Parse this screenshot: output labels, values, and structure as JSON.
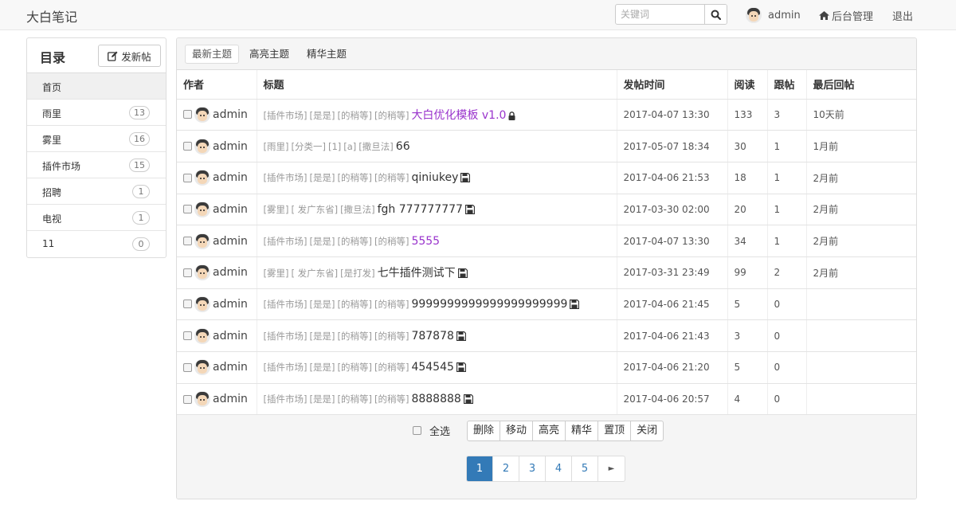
{
  "nav": {
    "brand": "大白笔记",
    "search_placeholder": "关键词",
    "username": "admin",
    "admin_link": "后台管理",
    "logout": "退出"
  },
  "sidebar": {
    "title": "目录",
    "new_post": "发新帖",
    "items": [
      {
        "label": "首页",
        "count": ""
      },
      {
        "label": "雨里",
        "count": "13"
      },
      {
        "label": "雾里",
        "count": "16"
      },
      {
        "label": "插件市场",
        "count": "15"
      },
      {
        "label": "招聘",
        "count": "1"
      },
      {
        "label": "电视",
        "count": "1"
      },
      {
        "label": "11",
        "count": "0"
      }
    ]
  },
  "tabs": [
    "最新主题",
    "高亮主题",
    "精华主题"
  ],
  "table": {
    "headers": [
      "作者",
      "标题",
      "发帖时间",
      "阅读",
      "跟帖",
      "最后回帖"
    ],
    "rows": [
      {
        "author": "admin",
        "tags": [
          "[插件市场]",
          "[是是]",
          "[的稍等]",
          "[的稍等]"
        ],
        "subject": "大白优化模板 v1.0",
        "style": "purple",
        "icon": "lock",
        "time": "2017-04-07 13:30",
        "views": "133",
        "replies": "3",
        "last": "10天前"
      },
      {
        "author": "admin",
        "tags": [
          "[雨里]",
          "[分类一]",
          "[1]",
          "[a]",
          "[撒旦法]"
        ],
        "subject": "66",
        "style": "normal",
        "icon": "",
        "time": "2017-05-07 18:34",
        "views": "30",
        "replies": "1",
        "last": "1月前"
      },
      {
        "author": "admin",
        "tags": [
          "[插件市场]",
          "[是是]",
          "[的稍等]",
          "[的稍等]"
        ],
        "subject": "qiniukey",
        "style": "normal",
        "icon": "disk",
        "time": "2017-04-06 21:53",
        "views": "18",
        "replies": "1",
        "last": "2月前"
      },
      {
        "author": "admin",
        "tags": [
          "[雾里]",
          "[ 发广东省]",
          "[撒旦法]"
        ],
        "subject": "fgh 777777777",
        "style": "normal",
        "icon": "disk",
        "time": "2017-03-30 02:00",
        "views": "20",
        "replies": "1",
        "last": "2月前"
      },
      {
        "author": "admin",
        "tags": [
          "[插件市场]",
          "[是是]",
          "[的稍等]",
          "[的稍等]"
        ],
        "subject": "5555",
        "style": "purple",
        "icon": "",
        "time": "2017-04-07 13:30",
        "views": "34",
        "replies": "1",
        "last": "2月前"
      },
      {
        "author": "admin",
        "tags": [
          "[雾里]",
          "[ 发广东省]",
          "[是打发]"
        ],
        "subject": "七牛插件测试下",
        "style": "normal",
        "icon": "disk",
        "time": "2017-03-31 23:49",
        "views": "99",
        "replies": "2",
        "last": "2月前"
      },
      {
        "author": "admin",
        "tags": [
          "[插件市场]",
          "[是是]",
          "[的稍等]",
          "[的稍等]"
        ],
        "subject": "9999999999999999999999",
        "style": "normal",
        "icon": "disk",
        "time": "2017-04-06 21:45",
        "views": "5",
        "replies": "0",
        "last": ""
      },
      {
        "author": "admin",
        "tags": [
          "[插件市场]",
          "[是是]",
          "[的稍等]",
          "[的稍等]"
        ],
        "subject": "787878",
        "style": "normal",
        "icon": "disk",
        "time": "2017-04-06 21:43",
        "views": "3",
        "replies": "0",
        "last": ""
      },
      {
        "author": "admin",
        "tags": [
          "[插件市场]",
          "[是是]",
          "[的稍等]",
          "[的稍等]"
        ],
        "subject": "454545",
        "style": "normal",
        "icon": "disk",
        "time": "2017-04-06 21:20",
        "views": "5",
        "replies": "0",
        "last": ""
      },
      {
        "author": "admin",
        "tags": [
          "[插件市场]",
          "[是是]",
          "[的稍等]",
          "[的稍等]"
        ],
        "subject": "8888888",
        "style": "normal",
        "icon": "disk",
        "time": "2017-04-06 20:57",
        "views": "4",
        "replies": "0",
        "last": ""
      }
    ]
  },
  "actions": {
    "select_all": "全选",
    "buttons": [
      "删除",
      "移动",
      "高亮",
      "精华",
      "置顶",
      "关闭"
    ]
  },
  "pagination": {
    "pages": [
      "1",
      "2",
      "3",
      "4",
      "5"
    ],
    "current": "1",
    "next": "►"
  },
  "colors": {
    "purple_title": "#9933cc",
    "primary": "#337ab7"
  }
}
